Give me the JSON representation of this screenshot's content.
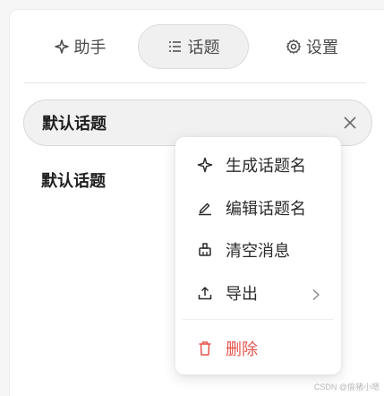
{
  "tabs": {
    "assistant": {
      "label": "助手",
      "icon": "sparkle-icon"
    },
    "topics": {
      "label": "话题",
      "icon": "list-icon"
    },
    "settings": {
      "label": "设置",
      "icon": "gear-icon"
    }
  },
  "topics": {
    "active": {
      "title": "默认话题",
      "close_icon": "close-icon"
    },
    "items": [
      {
        "title": "默认话题"
      }
    ]
  },
  "context_menu": {
    "items": [
      {
        "label": "生成话题名",
        "icon": "sparkle-icon"
      },
      {
        "label": "编辑话题名",
        "icon": "edit-icon"
      },
      {
        "label": "清空消息",
        "icon": "brush-icon"
      },
      {
        "label": "导出",
        "icon": "upload-icon",
        "submenu_icon": "chevron-right-icon"
      },
      {
        "label": "删除",
        "icon": "trash-icon",
        "color": "#e5534b"
      }
    ]
  },
  "watermark": "CSDN @偷猪小嗯"
}
